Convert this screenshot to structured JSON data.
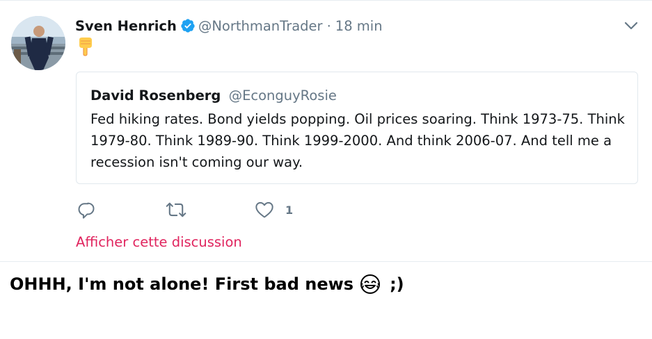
{
  "tweet": {
    "author_name": "Sven Henrich",
    "author_handle": "@NorthmanTrader",
    "separator": "·",
    "time": "18 min",
    "verified": true,
    "body_emoji": "pointing-down-emoji",
    "quote": {
      "author_name": "David Rosenberg",
      "author_handle": "@EconguyRosie",
      "text": "Fed hiking rates. Bond yields popping. Oil prices soaring. Think 1973-75. Think 1979-80. Think 1989-90. Think 1999-2000. And think 2006-07. And tell me a recession isn't coming our way."
    },
    "actions": {
      "like_count": "1"
    },
    "show_thread_label": "Afficher cette discussion"
  },
  "comment": {
    "text": "OHHH, I'm not alone! First bad news",
    "suffix": ";)"
  },
  "colors": {
    "accent_link": "#e0245e",
    "secondary_text": "#657786",
    "verified_blue": "#1da1f2",
    "border": "#e1e8ed"
  }
}
